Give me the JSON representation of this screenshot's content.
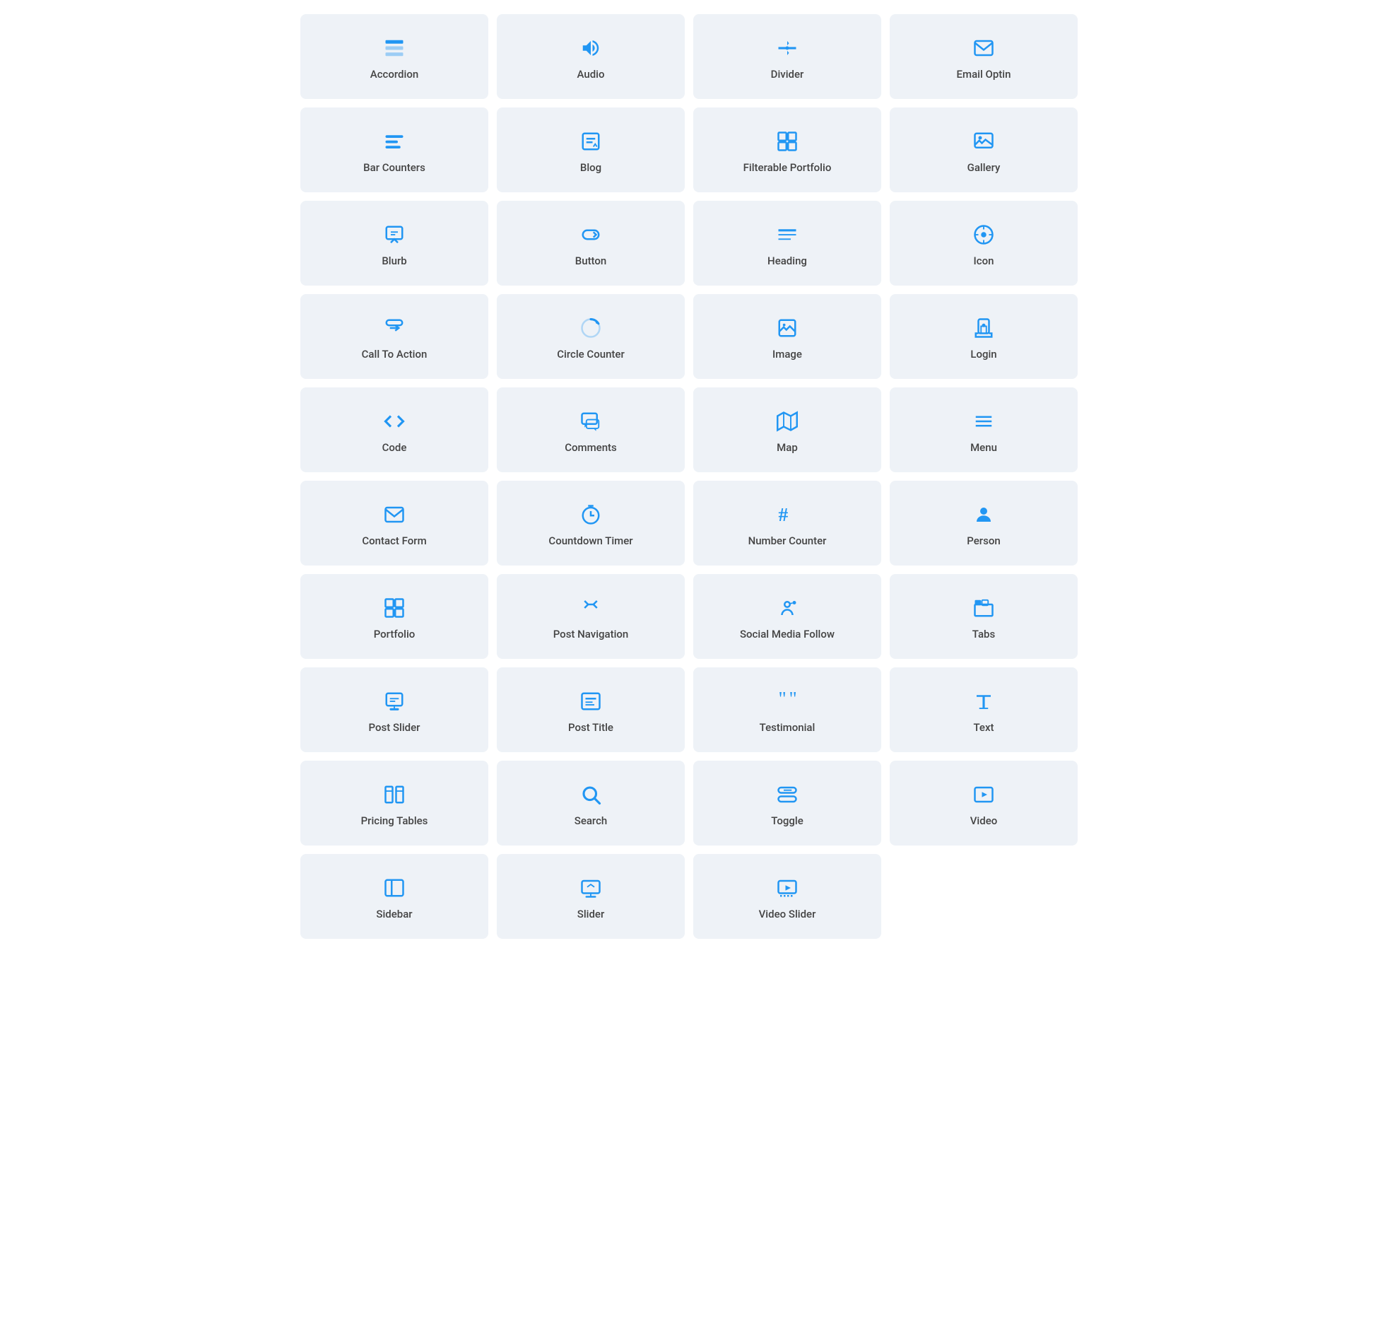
{
  "widgets": [
    {
      "id": "accordion",
      "label": "Accordion",
      "icon": "accordion"
    },
    {
      "id": "audio",
      "label": "Audio",
      "icon": "audio"
    },
    {
      "id": "divider",
      "label": "Divider",
      "icon": "divider"
    },
    {
      "id": "email-optin",
      "label": "Email Optin",
      "icon": "email"
    },
    {
      "id": "bar-counters",
      "label": "Bar Counters",
      "icon": "bar-counters"
    },
    {
      "id": "blog",
      "label": "Blog",
      "icon": "blog"
    },
    {
      "id": "filterable-portfolio",
      "label": "Filterable Portfolio",
      "icon": "filterable-portfolio"
    },
    {
      "id": "gallery",
      "label": "Gallery",
      "icon": "gallery"
    },
    {
      "id": "blurb",
      "label": "Blurb",
      "icon": "blurb"
    },
    {
      "id": "button",
      "label": "Button",
      "icon": "button"
    },
    {
      "id": "heading",
      "label": "Heading",
      "icon": "heading"
    },
    {
      "id": "icon",
      "label": "Icon",
      "icon": "icon"
    },
    {
      "id": "call-to-action",
      "label": "Call To Action",
      "icon": "call-to-action"
    },
    {
      "id": "circle-counter",
      "label": "Circle Counter",
      "icon": "circle-counter"
    },
    {
      "id": "image",
      "label": "Image",
      "icon": "image"
    },
    {
      "id": "login",
      "label": "Login",
      "icon": "login"
    },
    {
      "id": "code",
      "label": "Code",
      "icon": "code"
    },
    {
      "id": "comments",
      "label": "Comments",
      "icon": "comments"
    },
    {
      "id": "map",
      "label": "Map",
      "icon": "map"
    },
    {
      "id": "menu",
      "label": "Menu",
      "icon": "menu"
    },
    {
      "id": "contact-form",
      "label": "Contact Form",
      "icon": "contact-form"
    },
    {
      "id": "countdown-timer",
      "label": "Countdown Timer",
      "icon": "countdown-timer"
    },
    {
      "id": "number-counter",
      "label": "Number Counter",
      "icon": "number-counter"
    },
    {
      "id": "person",
      "label": "Person",
      "icon": "person"
    },
    {
      "id": "portfolio",
      "label": "Portfolio",
      "icon": "portfolio"
    },
    {
      "id": "post-navigation",
      "label": "Post Navigation",
      "icon": "post-navigation"
    },
    {
      "id": "social-media-follow",
      "label": "Social Media Follow",
      "icon": "social-media-follow"
    },
    {
      "id": "tabs",
      "label": "Tabs",
      "icon": "tabs"
    },
    {
      "id": "post-slider",
      "label": "Post Slider",
      "icon": "post-slider"
    },
    {
      "id": "post-title",
      "label": "Post Title",
      "icon": "post-title"
    },
    {
      "id": "testimonial",
      "label": "Testimonial",
      "icon": "testimonial"
    },
    {
      "id": "text",
      "label": "Text",
      "icon": "text"
    },
    {
      "id": "pricing-tables",
      "label": "Pricing Tables",
      "icon": "pricing-tables"
    },
    {
      "id": "search",
      "label": "Search",
      "icon": "search"
    },
    {
      "id": "toggle",
      "label": "Toggle",
      "icon": "toggle"
    },
    {
      "id": "video",
      "label": "Video",
      "icon": "video"
    },
    {
      "id": "sidebar",
      "label": "Sidebar",
      "icon": "sidebar"
    },
    {
      "id": "slider",
      "label": "Slider",
      "icon": "slider"
    },
    {
      "id": "video-slider",
      "label": "Video Slider",
      "icon": "video-slider"
    }
  ]
}
